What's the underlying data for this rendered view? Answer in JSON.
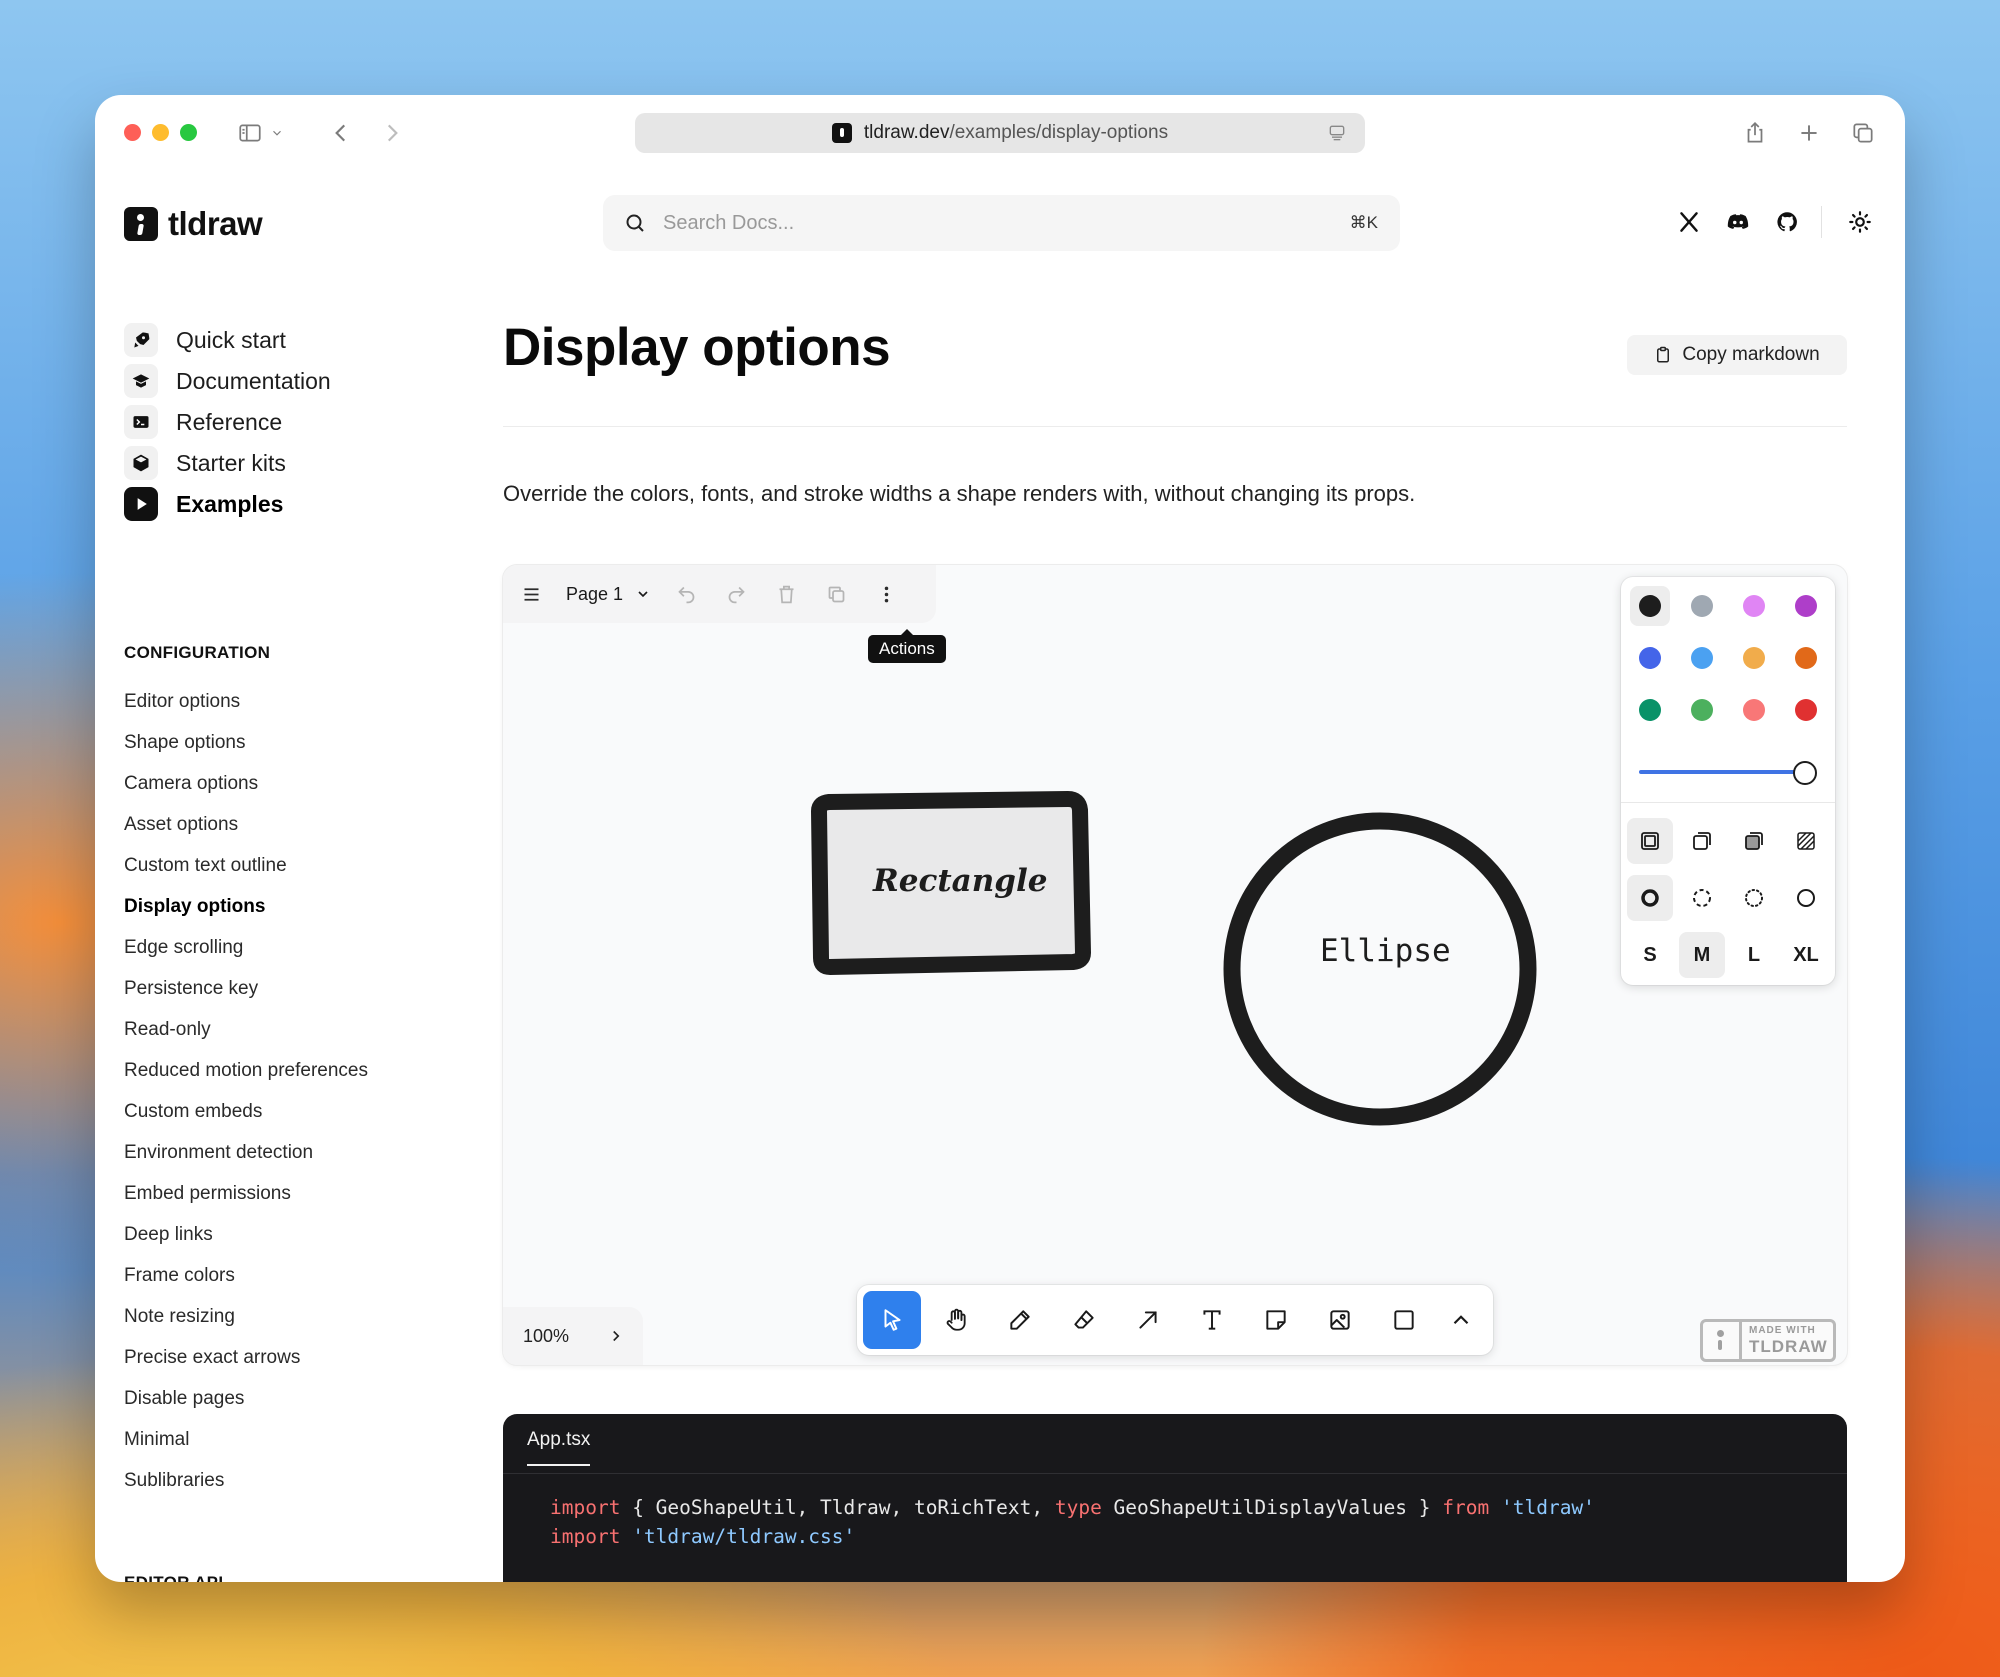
{
  "browser": {
    "url_host": "tldraw.dev",
    "url_path": "/examples/display-options"
  },
  "header": {
    "logo_text": "tldraw",
    "search_placeholder": "Search Docs...",
    "search_shortcut": "⌘K"
  },
  "sidebar": {
    "nav": [
      {
        "label": "Quick start",
        "icon": "rocket-icon"
      },
      {
        "label": "Documentation",
        "icon": "graduation-cap-icon"
      },
      {
        "label": "Reference",
        "icon": "terminal-icon"
      },
      {
        "label": "Starter kits",
        "icon": "box-icon"
      },
      {
        "label": "Examples",
        "icon": "play-icon",
        "active": true
      }
    ],
    "section_title": "CONFIGURATION",
    "examples": [
      "Editor options",
      "Shape options",
      "Camera options",
      "Asset options",
      "Custom text outline",
      "Display options",
      "Edge scrolling",
      "Persistence key",
      "Read-only",
      "Reduced motion preferences",
      "Custom embeds",
      "Environment detection",
      "Embed permissions",
      "Deep links",
      "Frame colors",
      "Note resizing",
      "Precise exact arrows",
      "Disable pages",
      "Minimal",
      "Sublibraries"
    ],
    "active_example": "Display options",
    "next_section_title": "EDITOR API"
  },
  "main": {
    "title": "Display options",
    "copy_button": "Copy markdown",
    "description": "Override the colors, fonts, and stroke widths a shape renders with, without changing its props."
  },
  "editor": {
    "page_name": "Page 1",
    "tooltip": "Actions",
    "zoom": "100%",
    "shapes": {
      "rectangle_label": "Rectangle",
      "ellipse_label": "Ellipse"
    },
    "colors": [
      "#1d1d1d",
      "#9fa8b2",
      "#e085f4",
      "#ae3ec9",
      "#4465e9",
      "#4ba1f1",
      "#f1ac4b",
      "#e16919",
      "#099268",
      "#4cb05e",
      "#f87777",
      "#e03131"
    ],
    "selected_color_index": 0,
    "opacity": 1.0,
    "sizes": [
      "S",
      "M",
      "L",
      "XL"
    ],
    "selected_size": "M",
    "made_with_line1": "MADE WITH",
    "made_with_line2": "TLDRAW",
    "accent": "#2f80ed"
  },
  "code": {
    "filename": "App.tsx",
    "line1": {
      "kw_import": "import",
      "names": " { GeoShapeUtil, Tldraw, toRichText, ",
      "kw_type": "type",
      "names2": " GeoShapeUtilDisplayValues } ",
      "kw_from": "from",
      "src": " 'tldraw'"
    },
    "line2": {
      "kw_import": "import",
      "src": " 'tldraw/tldraw.css'"
    }
  }
}
